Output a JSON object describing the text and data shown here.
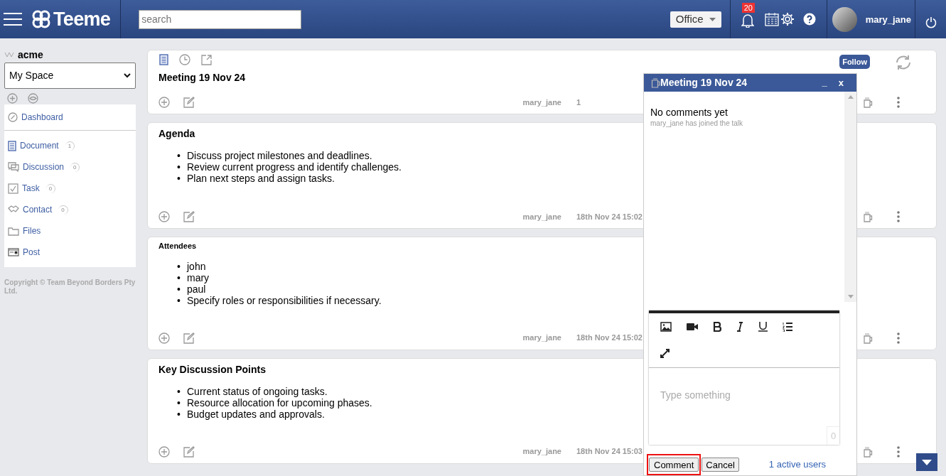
{
  "header": {
    "logo": "Teeme",
    "search": {
      "placeholder": "search"
    },
    "workplace": "Office",
    "notifications": "20",
    "username": "mary_jane"
  },
  "sidebar": {
    "org": "acme",
    "space": "My Space",
    "dashboard": {
      "label": "Dashboard",
      "kind": "dashboard"
    },
    "items": [
      {
        "label": "Document",
        "kind": "document",
        "count": "1"
      },
      {
        "label": "Discussion",
        "kind": "discussion",
        "count": "0"
      },
      {
        "label": "Task",
        "kind": "task",
        "count": "0"
      },
      {
        "label": "Contact",
        "kind": "contact",
        "count": "0"
      },
      {
        "label": "Files",
        "kind": "files"
      },
      {
        "label": "Post",
        "kind": "post"
      }
    ],
    "copyright": "Copyright © Team Beyond Borders Pty Ltd."
  },
  "document": {
    "follow": "Follow",
    "sections": [
      {
        "title": "Meeting 19 Nov 24",
        "kind": "main",
        "author": "mary_jane",
        "date": "1"
      },
      {
        "title": "Agenda",
        "kind": "heading",
        "marker": "•",
        "bullets": [
          "Discuss project milestones and deadlines.",
          "Review current progress and identify challenges.",
          "Plan next steps and assign tasks."
        ],
        "author": "mary_jane",
        "date": "18th Nov 24 15:02"
      },
      {
        "title": "Attendees",
        "kind": "subheading",
        "marker": "•",
        "bullets": [
          "john",
          "mary",
          "paul",
          "Specify roles or responsibilities if necessary."
        ],
        "author": "mary_jane",
        "date": "18th Nov 24 15:02"
      },
      {
        "title": "Key Discussion Points",
        "kind": "heading",
        "marker": "•",
        "bullets": [
          "Current status of ongoing tasks.",
          "Resource allocation for upcoming phases.",
          "Budget updates and approvals."
        ],
        "author": "mary_jane",
        "date": "18th Nov 24 15:03"
      }
    ]
  },
  "chat": {
    "title": "Meeting 19 Nov 24",
    "minimize": "_",
    "close": "x",
    "empty": "No comments yet",
    "event": "mary_jane has joined the talk",
    "placeholder": "Type something",
    "counter": "0",
    "comment": "Comment",
    "cancel": "Cancel",
    "active_users": "1 active users"
  }
}
